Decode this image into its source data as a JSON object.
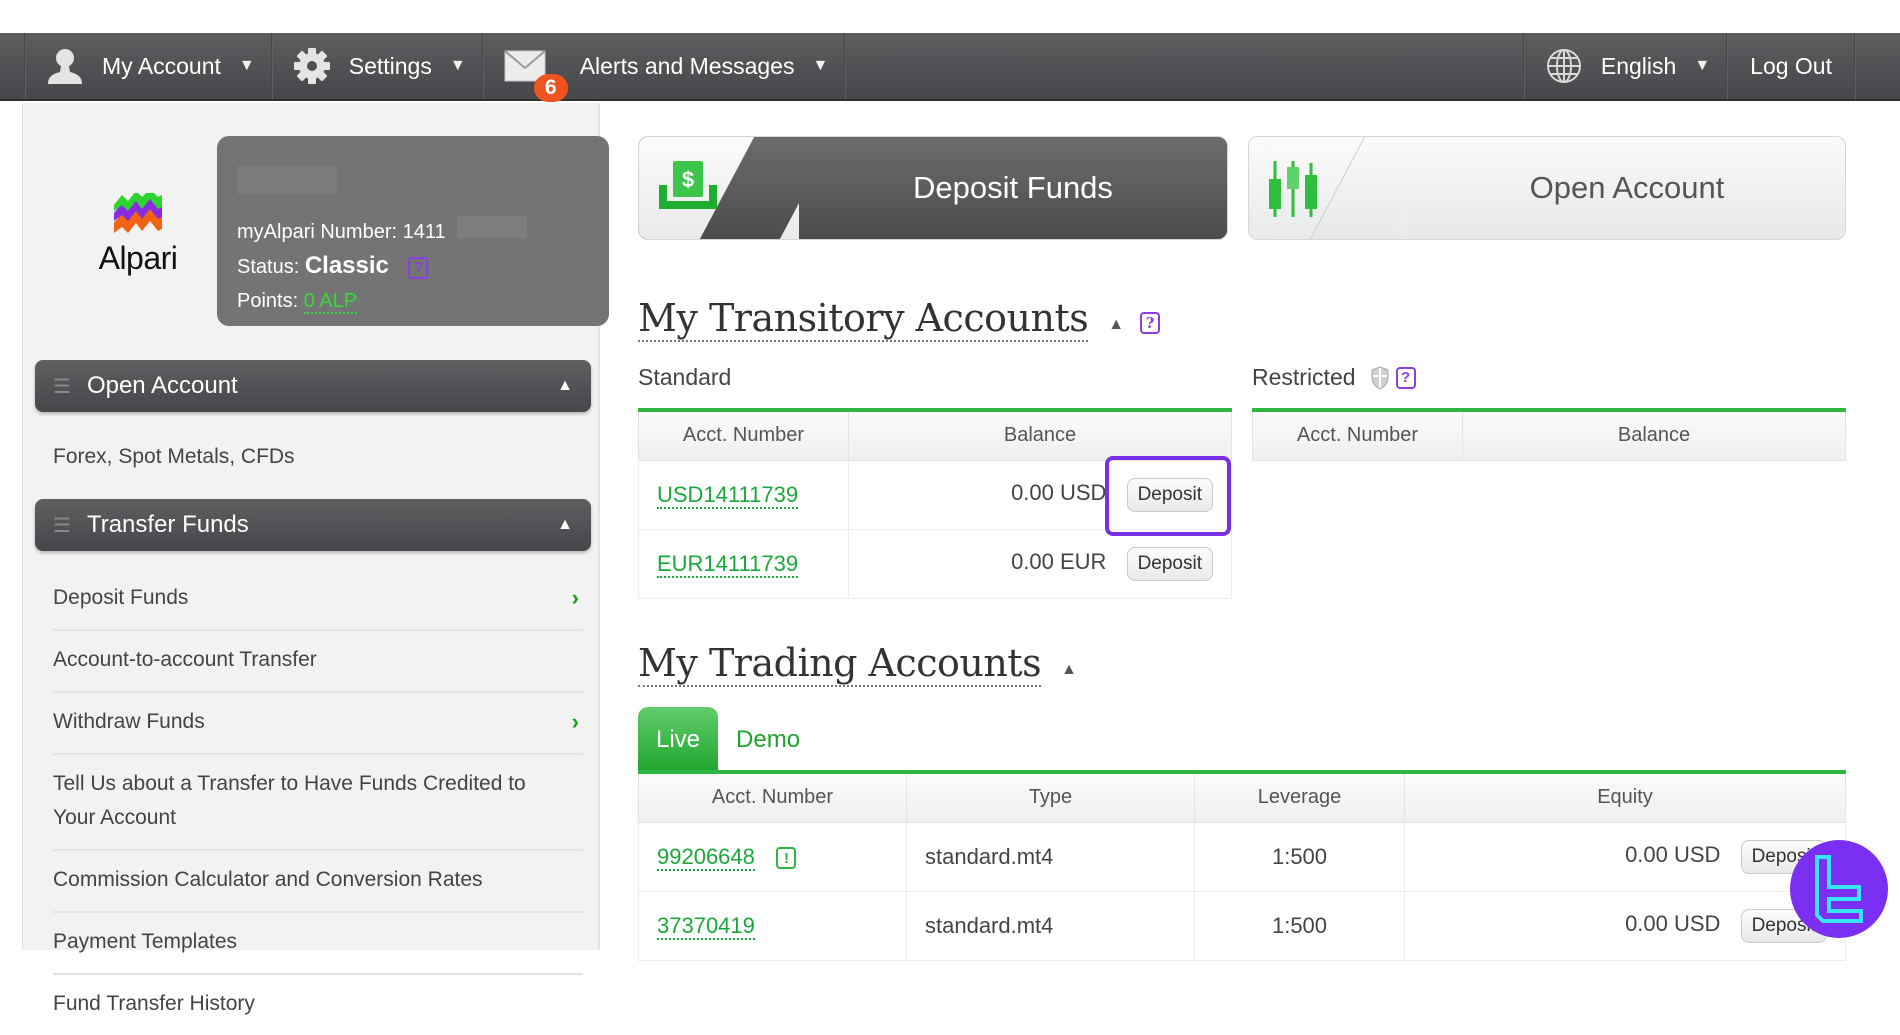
{
  "navbar": {
    "my_account": "My Account",
    "settings": "Settings",
    "alerts": "Alerts and Messages",
    "alerts_count": "6",
    "language": "English",
    "logout": "Log Out"
  },
  "profile": {
    "logo_text": "Alpari",
    "number_label": "myAlpari Number:",
    "number_value": "1411",
    "status_label": "Status:",
    "status_value": "Classic",
    "points_label": "Points:",
    "points_value": "0 ALP",
    "help": "?"
  },
  "sidebar": {
    "open_account_header": "Open Account",
    "open_account_text": "Forex, Spot Metals, CFDs",
    "transfer_header": "Transfer Funds",
    "items": [
      {
        "label": "Deposit Funds",
        "has_arrow": true
      },
      {
        "label": "Account-to-account Transfer",
        "has_arrow": false
      },
      {
        "label": "Withdraw Funds",
        "has_arrow": true
      },
      {
        "label": "Tell Us about a Transfer to Have Funds Credited to Your Account",
        "has_arrow": false
      },
      {
        "label": "Commission Calculator and Conversion Rates",
        "has_arrow": false
      },
      {
        "label": "Payment Templates",
        "has_arrow": false
      },
      {
        "label": "Fund Transfer History",
        "has_arrow": false
      }
    ]
  },
  "actions": {
    "deposit_funds": "Deposit Funds",
    "open_account": "Open Account"
  },
  "transitory": {
    "title": "My Transitory Accounts",
    "help": "?",
    "standard": {
      "label": "Standard",
      "headers": [
        "Acct. Number",
        "Balance"
      ],
      "rows": [
        {
          "account": "USD14111739",
          "balance": "0.00 USD",
          "action": "Deposit"
        },
        {
          "account": "EUR14111739",
          "balance": "0.00 EUR",
          "action": "Deposit"
        }
      ]
    },
    "restricted": {
      "label": "Restricted",
      "help": "?",
      "headers": [
        "Acct. Number",
        "Balance"
      ]
    }
  },
  "trading": {
    "title": "My Trading Accounts",
    "tabs": [
      {
        "label": "Live",
        "active": true
      },
      {
        "label": "Demo",
        "active": false
      }
    ],
    "headers": [
      "Acct. Number",
      "Type",
      "Leverage",
      "Equity"
    ],
    "rows": [
      {
        "account": "99206648",
        "warning": "!",
        "type": "standard.mt4",
        "leverage": "1:500",
        "equity": "0.00 USD",
        "action": "Deposit"
      },
      {
        "account": "37370419",
        "warning": "",
        "type": "standard.mt4",
        "leverage": "1:500",
        "equity": "0.00 USD",
        "action": "Deposit"
      }
    ]
  },
  "colors": {
    "accent_green": "#1ea52e",
    "highlight_purple": "#7a2ee6",
    "badge_orange": "#f0541e",
    "navbar": "#4f5153"
  }
}
